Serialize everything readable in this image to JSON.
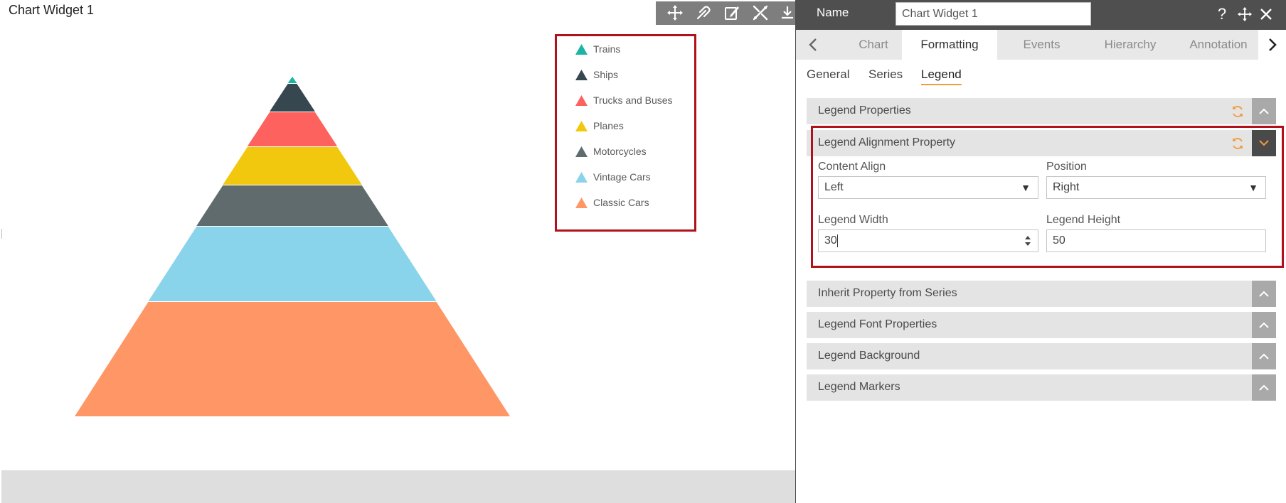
{
  "widget": {
    "title": "Chart Widget 1"
  },
  "chart_data": {
    "type": "pyramid",
    "series": [
      {
        "name": "Trains",
        "color": "#1cb5a3"
      },
      {
        "name": "Ships",
        "color": "#37474f"
      },
      {
        "name": "Trucks and Buses",
        "color": "#fd625e"
      },
      {
        "name": "Planes",
        "color": "#f2c80f"
      },
      {
        "name": "Motorcycles",
        "color": "#5f6b6d"
      },
      {
        "name": "Vintage Cars",
        "color": "#8ad4eb"
      },
      {
        "name": "Classic Cars",
        "color": "#fe9666"
      }
    ]
  },
  "toolbar": {
    "icons": [
      "move-icon",
      "link-icon",
      "edit-icon",
      "tools-icon",
      "download-icon"
    ]
  },
  "panel": {
    "name_label": "Name",
    "name_value": "Chart Widget 1",
    "icons": [
      "help-icon",
      "move-icon",
      "close-icon"
    ],
    "tabs": [
      "Chart",
      "Formatting",
      "Events",
      "Hierarchy",
      "Annotation"
    ],
    "active_tab": "Formatting",
    "subtabs": [
      "General",
      "Series",
      "Legend"
    ],
    "active_subtab": "Legend",
    "sections": {
      "legend_properties": "Legend Properties",
      "alignment": "Legend Alignment Property",
      "inherit": "Inherit Property from Series",
      "font": "Legend Font Properties",
      "background": "Legend Background",
      "markers": "Legend Markers"
    },
    "alignment": {
      "content_align_label": "Content Align",
      "content_align_value": "Left",
      "position_label": "Position",
      "position_value": "Right",
      "width_label": "Legend Width",
      "width_value": "30",
      "height_label": "Legend Height",
      "height_value": "50"
    },
    "colors": {
      "accent": "#f29c3a",
      "highlight": "#b0121b"
    }
  }
}
